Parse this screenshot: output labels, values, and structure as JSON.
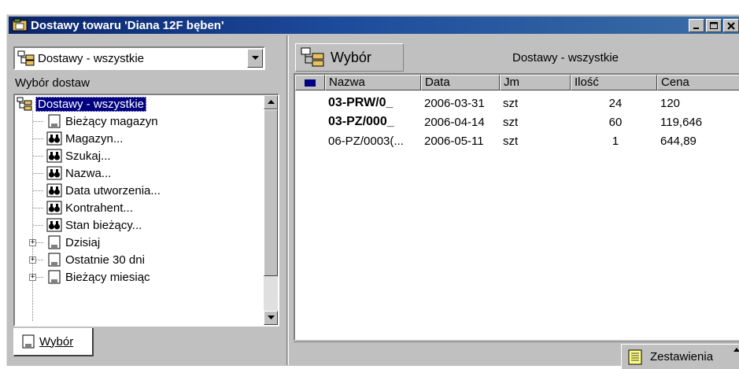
{
  "window": {
    "title": "Dostawy towaru 'Diana 12F bęben'",
    "buttons": [
      "minimize",
      "maximize",
      "close"
    ]
  },
  "left_panel": {
    "view_select": {
      "value": "Dostawy - wszystkie"
    },
    "section_label": "Wybór dostaw",
    "tree": [
      {
        "label": "Dostawy - wszystkie",
        "icon": "folder-tree-icon",
        "level": 0,
        "selected": true
      },
      {
        "label": "Bieżący magazyn",
        "icon": "document-icon",
        "level": 1
      },
      {
        "label": "Magazyn...",
        "icon": "binoculars-icon",
        "level": 1
      },
      {
        "label": "Szukaj...",
        "icon": "binoculars-icon",
        "level": 1
      },
      {
        "label": "Nazwa...",
        "icon": "binoculars-icon",
        "level": 1
      },
      {
        "label": "Data utworzenia...",
        "icon": "binoculars-icon",
        "level": 1
      },
      {
        "label": "Kontrahent...",
        "icon": "binoculars-icon",
        "level": 1
      },
      {
        "label": "Stan bieżący...",
        "icon": "binoculars-icon",
        "level": 1
      },
      {
        "label": "Dzisiaj",
        "icon": "document-icon",
        "level": 1,
        "expandable": true
      },
      {
        "label": "Ostatnie 30 dni",
        "icon": "document-icon",
        "level": 1,
        "expandable": true
      },
      {
        "label": "Bieżący miesiąc",
        "icon": "document-icon",
        "level": 1,
        "expandable": true
      }
    ],
    "tab_label": "Wybór"
  },
  "right_panel": {
    "wybor_button": "Wybór",
    "view_title": "Dostawy - wszystkie",
    "columns": [
      "Nazwa",
      "Data",
      "Jm",
      "Ilość",
      "Cena"
    ],
    "rows": [
      {
        "nazwa": "03-PRW/0_",
        "data": "2006-03-31",
        "jm": "szt",
        "ilosc": "24",
        "cena": "120",
        "bold": true
      },
      {
        "nazwa": "03-PZ/000_",
        "data": "2006-04-14",
        "jm": "szt",
        "ilosc": "60",
        "cena": "119,646",
        "bold": true
      },
      {
        "nazwa": "06-PZ/0003(...",
        "data": "2006-05-11",
        "jm": "szt",
        "ilosc": "1",
        "cena": "644,89",
        "bold": false
      }
    ],
    "zestawienia_button": "Zestawienia"
  },
  "colors": {
    "title_bar": "#0a246a",
    "selection": "#000080",
    "face": "#c0c0c0"
  }
}
